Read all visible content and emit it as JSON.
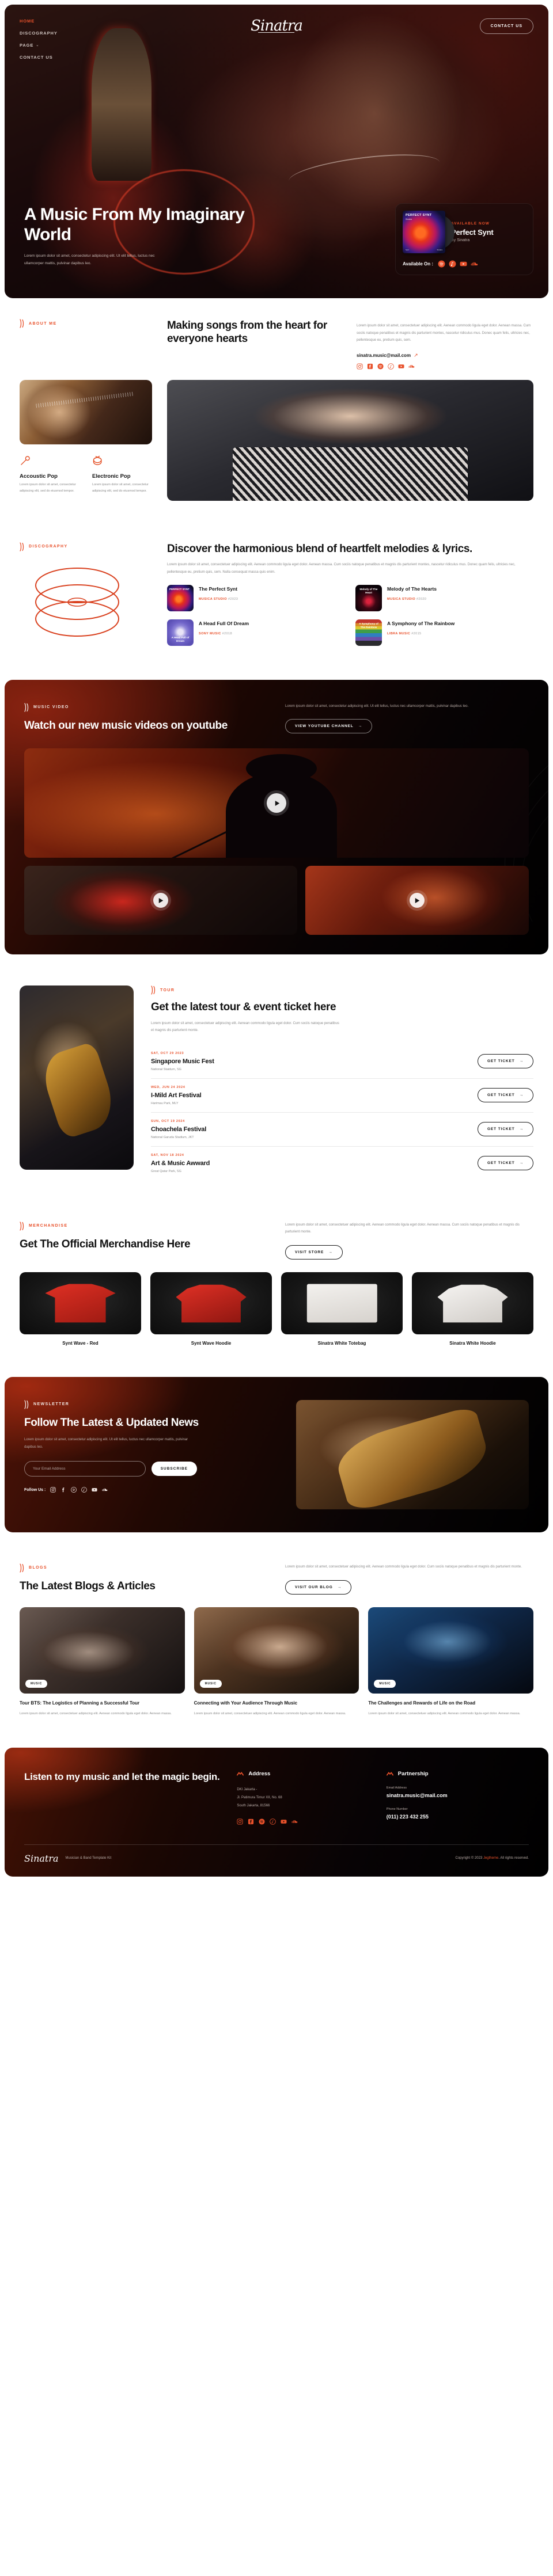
{
  "brand": {
    "logo_text": "Sinatra",
    "accent": "#e8512b",
    "dark": "#121212"
  },
  "nav": {
    "items": [
      {
        "label": "HOME",
        "active": true
      },
      {
        "label": "DISCOGRAPHY",
        "active": false
      },
      {
        "label": "PAGE",
        "active": false,
        "caret": "⌄"
      },
      {
        "label": "CONTACT US",
        "active": false
      }
    ],
    "cta_label": "CONTACT US"
  },
  "hero": {
    "title": "A Music From My Imaginary World",
    "subtitle": "Lorem ipsum dolor sit amet, consectetur adipiscing elit. Ut elit tellus, luctus nec ullamcorper mattis, pulvinar dapibus leo.",
    "release": {
      "eyebrow": "AVAILABLE NOW",
      "title": "Perfect Synt",
      "by": "By Sinatra",
      "available_on_label": "Available On :",
      "cover_title": "PERFECT SYNT",
      "cover_sub": "Sinatra",
      "cover_foot_left": "Synt",
      "cover_foot_right": "Sinatra",
      "platforms": [
        "spotify-icon",
        "apple-music-icon",
        "youtube-icon",
        "soundcloud-icon"
      ]
    }
  },
  "about": {
    "eyebrow": "ABOUT ME",
    "heading": "Making songs from the heart for everyone hearts",
    "paragraph": "Lorem ipsum dolor sit amet, consectetuer adipiscing elit. Aenean commodo ligula eget dolor. Aenean massa. Cum sociis natoque penatibus et magnis dis parturient montes, nascetur ridiculus mus. Donec quam felis, ultricies nec, pellentesque eu, pretium quis, sem.",
    "email": "sinatra.music@mail.com",
    "socials": [
      "instagram-icon",
      "facebook-icon",
      "spotify-icon",
      "apple-music-icon",
      "youtube-icon",
      "soundcloud-icon"
    ],
    "genres": [
      {
        "icon": "microphone-icon",
        "title": "Accoustic Pop",
        "desc": "Lorem ipsum dolor sit amet, consectetur adipiscing elit, sed do eiusmod tempor."
      },
      {
        "icon": "drum-icon",
        "title": "Electronic Pop",
        "desc": "Lorem ipsum dolor sit amet, consectetur adipiscing elit, sed do eiusmod tempor."
      }
    ]
  },
  "discography": {
    "eyebrow": "DISCOGRAPHY",
    "heading": "Discover the harmonious blend of heartfelt melodies & lyrics.",
    "paragraph": "Lorem ipsum dolor sit amet, consectetuer adipiscing elit. Aenean commodo ligula eget dolor. Aenean massa. Cum sociis natoque penatibus et magnis dis parturient montes, nascetur ridiculus mus. Donec quam felis, ultricies nec, pellentesque eu, pretium quis, sem. Nulla consequat massa quis enim.",
    "albums": [
      {
        "title": "The Perfect Synt",
        "label": "MUSICA STUDIO",
        "year": "#2023",
        "cover_text": "PERFECT SYNT"
      },
      {
        "title": "Melody of The Hearts",
        "label": "MUSICA STUDIO",
        "year": "#2020",
        "cover_text": "Melody of The Heart"
      },
      {
        "title": "A Head Full Of Dream",
        "label": "SONY MUSIC",
        "year": "#2018",
        "cover_text": "A Head Full of Dream"
      },
      {
        "title": "A Symphony of The Rainbow",
        "label": "LIBRA MUSIC",
        "year": "#2015",
        "cover_text": "A Symphony of The Rainbow"
      }
    ]
  },
  "music_video": {
    "eyebrow": "MUSIC VIDEO",
    "heading": "Watch our new music videos on youtube",
    "paragraph": "Lorem ipsum dolor sit amet, consectetur adipiscing elit. Ut elit tellus, luctus nec ullamcorper mattis, pulvinar dapibus leo.",
    "cta_label": "VIEW YOUTUBE CHANNEL",
    "cta_arrow": "→",
    "play_label": "play-button"
  },
  "tour": {
    "eyebrow": "TOUR",
    "heading": "Get the latest tour & event ticket here",
    "paragraph": "Lorem ipsum dolor sit amet, consectetuer adipiscing elit. Aenean commodo ligula eget dolor. Cum sociis natoque penatibus et magnis dis parturient monte.",
    "ticket_label": "GET TICKET",
    "ticket_arrow": "→",
    "events": [
      {
        "date": "SAT, OCT 29 2023",
        "name": "Singapore Music Fest",
        "venue": "National Staidum, SG"
      },
      {
        "date": "WED, JUN 24 2024",
        "name": "I-Mild Art Festival",
        "venue": "Harimau Park, MLY"
      },
      {
        "date": "SUN, OCT 19 2024",
        "name": "Choachela Festival",
        "venue": "National Garuda Stadium, JKT"
      },
      {
        "date": "SAT, NOV 18 2024",
        "name": "Art & Music Awward",
        "venue": "Great Qatar Park, SG"
      }
    ]
  },
  "merchandise": {
    "eyebrow": "MERCHANDISE",
    "heading": "Get The Official Merchandise Here",
    "paragraph": "Lorem ipsum dolor sit amet, consectetuer adipiscing elit. Aenean commodo ligula eget dolor. Aenean massa. Cum sociis natoque penatibus et magnis dis parturient monte.",
    "cta_label": "VISIT STORE",
    "cta_arrow": "→",
    "items": [
      {
        "name": "Synt Wave - Red"
      },
      {
        "name": "Synt Wave Hoodie"
      },
      {
        "name": "Sinatra White Totebag"
      },
      {
        "name": "Sinatra White Hoodie"
      }
    ]
  },
  "newsletter": {
    "eyebrow": "NEWSLETTER",
    "heading": "Follow The Latest & Updated News",
    "paragraph": "Lorem ipsum dolor sit amet, consectetur adipiscing elit. Ut elit tellus, luctus nec ullamcorper mattis, pulvinar dapibus leo.",
    "input_placeholder": "Your Email Address",
    "input_value": "",
    "subscribe_label": "SUBSCRIBE",
    "follow_label": "Follow Us :",
    "socials": [
      "instagram-icon",
      "facebook-icon",
      "spotify-icon",
      "apple-music-icon",
      "youtube-icon",
      "soundcloud-icon"
    ]
  },
  "blogs": {
    "eyebrow": "BLOGS",
    "heading": "The Latest Blogs & Articles",
    "paragraph": "Lorem ipsum dolor sit amet, consectetuer adipiscing elit. Aenean commodo ligula eget dolor. Cum sociis natoque penatibus et magnis dis parturient monte.",
    "cta_label": "VISIT OUR BLOG",
    "cta_arrow": "→",
    "posts": [
      {
        "tag": "MUSIC",
        "title": "Tour BTS: The Logistics of Planning a Successful Tour",
        "desc": "Lorem ipsum dolor sit amet, consectetuer adipiscing elit. Aenean commodo ligula eget dolor. Aenean massa."
      },
      {
        "tag": "MUSIC",
        "title": "Connecting with Your Audience Through Music",
        "desc": "Lorem ipsum dolor sit amet, consectetuer adipiscing elit. Aenean commodo ligula eget dolor. Aenean massa."
      },
      {
        "tag": "MUSIC",
        "title": "The Challenges and Rewards of Life on the Road",
        "desc": "Lorem ipsum dolor sit amet, consectetuer adipiscing elit. Aenean commodo ligula eget dolor. Aenean massa."
      }
    ]
  },
  "footer": {
    "heading": "Listen to my music and let the magic begin.",
    "address": {
      "title": "Address",
      "line1": "DKI Jakarta -",
      "line2": "Jl. Patimura Timur XII, No. 68",
      "line3": "South Jakarta, 81566"
    },
    "socials": [
      "instagram-icon",
      "facebook-icon",
      "spotify-icon",
      "apple-music-icon",
      "youtube-icon",
      "soundcloud-icon"
    ],
    "partnership": {
      "title": "Partnership",
      "email_label": "Email Address",
      "email": "sinatra.music@mail.com",
      "phone_label": "Phone Number",
      "phone": "(011) 223 432 255"
    },
    "logo_text": "Sinatra",
    "kit_text": "Musician & Band Template Kit",
    "copyright_pre": "Copyright © 2023 ",
    "copyright_brand": "Jegtheme",
    "copyright_post": ". All rights reserved."
  }
}
